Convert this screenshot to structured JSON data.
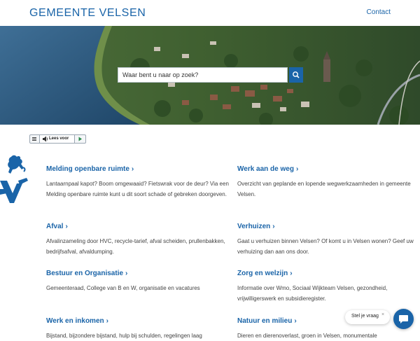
{
  "header": {
    "logo_text": "GEMEENTE VELSEN",
    "contact_label": "Contact"
  },
  "hero": {
    "search_placeholder": "Waar bent u naar op zoek?",
    "search_icon": "magnifier-icon"
  },
  "reader": {
    "label": "Lees voor",
    "icons": [
      "menu-icon",
      "speaker-icon",
      "play-icon"
    ]
  },
  "items": [
    {
      "title": "Melding openbare ruimte",
      "desc": "Lantaarnpaal kapot? Boom omgewaaid? Fietswrak voor de deur? Via een Melding openbare ruimte kunt u dit soort schade of gebreken doorgeven."
    },
    {
      "title": "Werk aan de weg",
      "desc": "Overzicht van geplande en lopende wegwerkzaamheden in gemeente Velsen."
    },
    {
      "title": "Afval",
      "desc": "Afvalinzameling door HVC, recycle-tarief, afval scheiden, prullenbakken, bedrijfsafval, afvaldumping."
    },
    {
      "title": "Verhuizen",
      "desc": "Gaat u verhuizen binnen Velsen? Of komt u in Velsen wonen? Geef uw verhuizing dan aan ons door."
    },
    {
      "title": "Bestuur en Organisatie",
      "desc": "Gemeenteraad, College van B en W, organisatie en vacatures"
    },
    {
      "title": "Zorg en welzijn",
      "desc": "Informatie over Wmo, Sociaal Wijkteam Velsen, gezondheid, vrijwilligerswerk en subsidieregister."
    },
    {
      "title": "Werk en inkomen",
      "desc": "Bijstand, bijzondere bijstand, hulp bij schulden, regelingen laag"
    },
    {
      "title": "Natuur en milieu",
      "desc": "Dieren en dierenoverlast, groen in Velsen, monumentale"
    }
  ],
  "chat": {
    "prompt": "Stel je vraag",
    "close_symbol": "×",
    "icon": "chat-bubble-icon"
  },
  "colors": {
    "brand_blue": "#1a64a8",
    "text": "#444444"
  }
}
